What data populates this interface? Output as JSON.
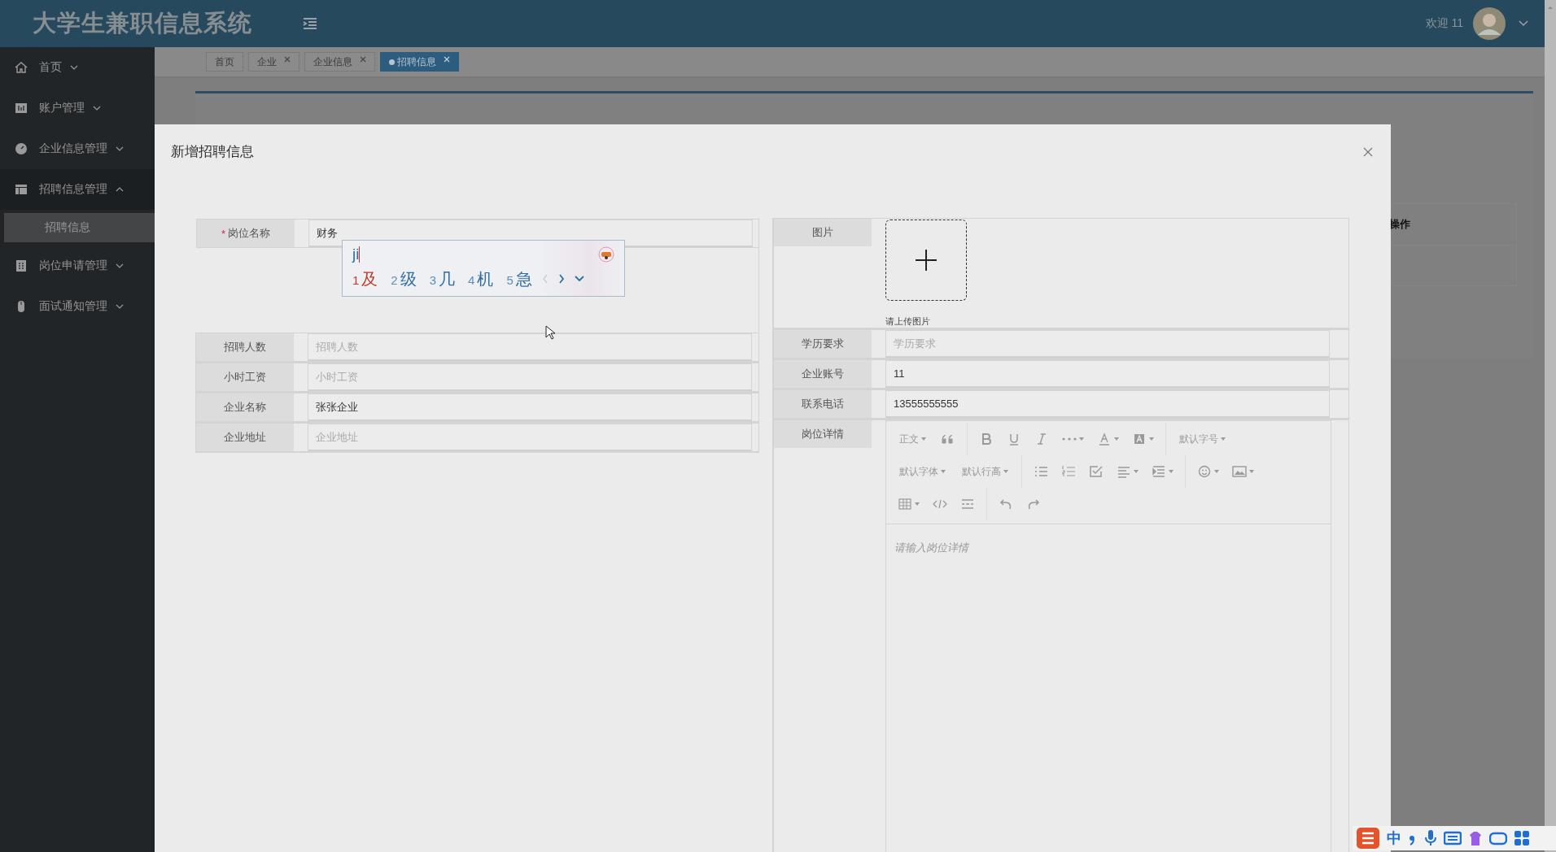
{
  "header": {
    "title": "大学生兼职信息系统",
    "welcome": "欢迎 11"
  },
  "sidebar": {
    "items": [
      {
        "label": "首页",
        "expanded": false
      },
      {
        "label": "账户管理",
        "expanded": false
      },
      {
        "label": "企业信息管理",
        "expanded": false
      },
      {
        "label": "招聘信息管理",
        "expanded": true,
        "children": [
          {
            "label": "招聘信息",
            "selected": true
          }
        ]
      },
      {
        "label": "岗位申请管理",
        "expanded": false
      },
      {
        "label": "面试通知管理",
        "expanded": false
      }
    ]
  },
  "tabs": [
    {
      "label": "首页",
      "selected": false,
      "closable": false
    },
    {
      "label": "企业",
      "selected": false,
      "closable": true
    },
    {
      "label": "企业信息",
      "selected": false,
      "closable": true
    },
    {
      "label": "招聘信息",
      "selected": true,
      "closable": true
    }
  ],
  "table": {
    "columns": [
      "操作"
    ]
  },
  "dialog": {
    "title": "新增招聘信息",
    "left_fields": [
      {
        "label": "岗位名称",
        "mark": "*",
        "value": "财务"
      },
      {
        "label": "招聘人数",
        "placeholder": "招聘人数"
      },
      {
        "label": "小时工资",
        "placeholder": "小时工资"
      },
      {
        "label": "企业名称",
        "value": "张张企业"
      },
      {
        "label": "企业地址",
        "placeholder": "企业地址"
      }
    ],
    "image_upload": {
      "label": "图片",
      "hint": "请上传图片"
    },
    "right_fields": [
      {
        "label": "学历要求",
        "placeholder": "学历要求"
      },
      {
        "label": "企业账号",
        "value": "11"
      },
      {
        "label": "联系电话",
        "value": "13555555555"
      }
    ],
    "editor": {
      "label": "岗位详情",
      "placeholder": "请输入岗位详情",
      "toolbar": [
        [
          [
            {
              "kind": "text",
              "label": "正文",
              "dropdown": true
            },
            {
              "kind": "quote",
              "dropdown": false
            }
          ],
          [
            {
              "kind": "bold",
              "dropdown": false
            },
            {
              "kind": "underline",
              "dropdown": false
            },
            {
              "kind": "italic",
              "dropdown": false
            },
            {
              "kind": "more",
              "dropdown": true
            },
            {
              "kind": "font-color",
              "dropdown": true
            },
            {
              "kind": "back-color",
              "dropdown": true
            }
          ],
          [
            {
              "kind": "text",
              "label": "默认字号",
              "dropdown": true
            }
          ]
        ],
        [
          [
            {
              "kind": "text",
              "label": "默认字体",
              "dropdown": true
            },
            {
              "kind": "text",
              "label": "默认行高",
              "dropdown": true
            }
          ],
          [
            {
              "kind": "bullet-list",
              "dropdown": false
            },
            {
              "kind": "number-list",
              "dropdown": false
            },
            {
              "kind": "todo",
              "dropdown": false
            },
            {
              "kind": "align",
              "dropdown": true
            },
            {
              "kind": "indent",
              "dropdown": true
            }
          ],
          [
            {
              "kind": "emoji",
              "dropdown": true
            },
            {
              "kind": "image",
              "dropdown": true
            }
          ]
        ],
        [
          [
            {
              "kind": "table",
              "dropdown": true
            },
            {
              "kind": "code",
              "dropdown": false
            },
            {
              "kind": "divider",
              "dropdown": false
            }
          ],
          [
            {
              "kind": "undo",
              "dropdown": false
            },
            {
              "kind": "redo",
              "dropdown": false
            }
          ]
        ]
      ]
    }
  },
  "ime": {
    "input": "ji",
    "candidates": [
      {
        "number": "1",
        "char": "及",
        "selected": true
      },
      {
        "number": "2",
        "char": "级",
        "selected": false
      },
      {
        "number": "3",
        "char": "几",
        "selected": false
      },
      {
        "number": "4",
        "char": "机",
        "selected": false
      },
      {
        "number": "5",
        "char": "急",
        "selected": false
      }
    ]
  },
  "ime_status": {
    "mode": "中"
  }
}
